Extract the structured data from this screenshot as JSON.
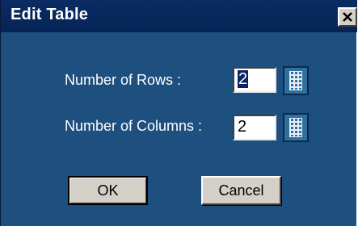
{
  "window": {
    "title": "Edit Table"
  },
  "form": {
    "rows_label": "Number of Rows :",
    "rows_value": "2",
    "columns_label": "Number of Columns :",
    "columns_value": "2"
  },
  "buttons": {
    "ok_label": "OK",
    "cancel_label": "Cancel"
  },
  "icons": {
    "close": "close-icon",
    "grid": "grid-icon"
  },
  "colors": {
    "dialog_bg": "#1d4f7f",
    "titlebar_bg": "#062456",
    "button_face": "#d4d0c8",
    "selection": "#0a246a"
  }
}
